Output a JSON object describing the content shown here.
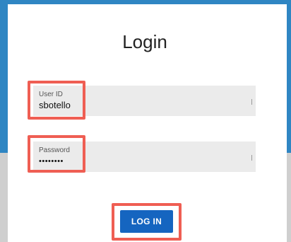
{
  "login": {
    "title": "Login",
    "user_id": {
      "label": "User ID",
      "value": "sbotello"
    },
    "password": {
      "label": "Password",
      "value": "••••••••"
    },
    "submit_label": "LOG IN"
  },
  "colors": {
    "header_blue": "#2f86c3",
    "highlight": "#ef5e53",
    "button": "#1565c0",
    "field_bg": "#ebebeb"
  }
}
